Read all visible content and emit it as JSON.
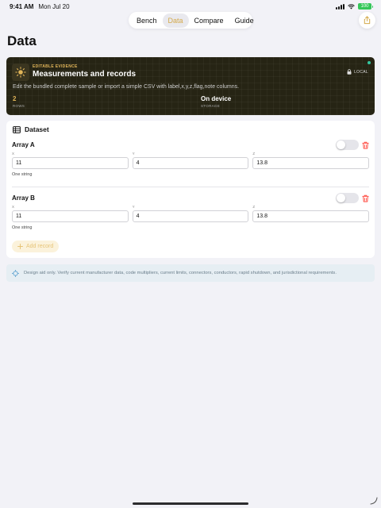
{
  "status": {
    "time": "9:41 AM",
    "date": "Mon Jul 20",
    "battery": "100"
  },
  "nav": {
    "tabs": [
      "Bench",
      "Data",
      "Compare",
      "Guide"
    ],
    "active_index": 1
  },
  "page": {
    "title": "Data"
  },
  "hero": {
    "eyebrow": "EDITABLE EVIDENCE",
    "title": "Measurements and records",
    "badge": "LOCAL",
    "description": "Edit the bundled complete sample or import a simple CSV with label,x,y,z,flag,note columns.",
    "stats": [
      {
        "value": "2",
        "label": "ROWS"
      },
      {
        "value": "On device",
        "label": "STORAGE"
      }
    ]
  },
  "dataset": {
    "title": "Dataset",
    "field_labels": {
      "x": "X",
      "y": "Y",
      "z": "Z"
    },
    "records": [
      {
        "label": "Array A",
        "x": "11",
        "y": "4",
        "z": "13.8",
        "note": "One string",
        "flag": false
      },
      {
        "label": "Array B",
        "x": "11",
        "y": "4",
        "z": "13.8",
        "note": "One string",
        "flag": false
      }
    ],
    "add_label": "Add record"
  },
  "disclaimer": "Design aid only. Verify current manufacturer data, code multipliers, current limits, connectors, conductors, rapid shutdown, and jurisdictional requirements.",
  "colors": {
    "accent": "#d4a94a",
    "hero_bg": "#262414",
    "delete": "#ff3b30",
    "info": "#5aa0d0"
  }
}
